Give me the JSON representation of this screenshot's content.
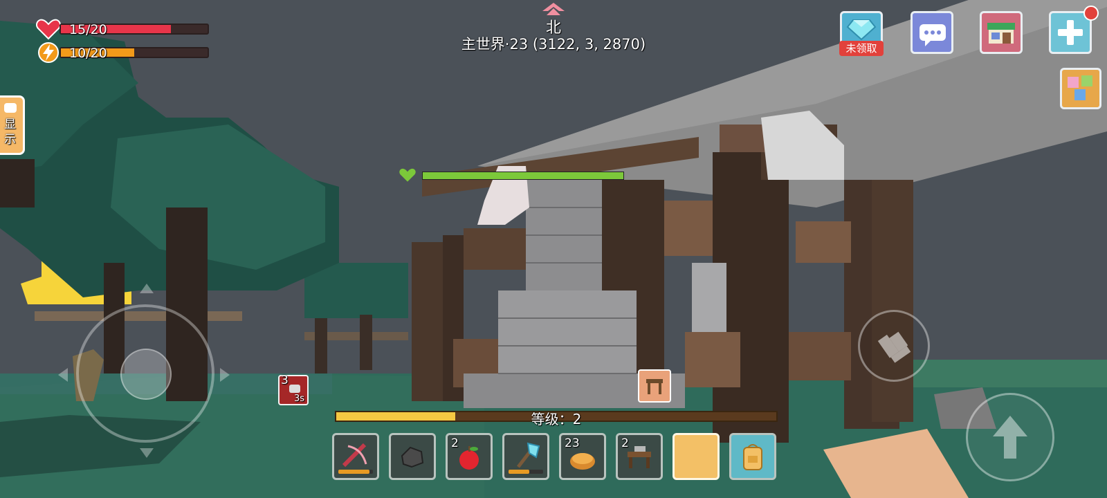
{
  "hud": {
    "health": {
      "value": 15,
      "max": 20,
      "label": "15/20",
      "color": "#e8354a"
    },
    "hunger": {
      "value": 10,
      "max": 20,
      "label": "10/20",
      "color": "#f29a1a"
    }
  },
  "compass": {
    "direction": "北",
    "location": "主世界·23 (3122, 3, 2870)"
  },
  "top_buttons": [
    {
      "name": "diamond-reward-button",
      "badge": "未领取",
      "color": "#5db8d6"
    },
    {
      "name": "chat-button",
      "color": "#7b88d9"
    },
    {
      "name": "shop-button",
      "color": "#d06a7c"
    },
    {
      "name": "add-button",
      "color": "#6ec3d6"
    }
  ],
  "side_chat": {
    "label": "显\n示"
  },
  "target": {
    "health_fraction": 1.0,
    "color": "#7cc83a"
  },
  "buff": {
    "count": "3",
    "timer": "3s"
  },
  "level": {
    "label": "等级：2",
    "progress": 0.27,
    "color": "#f5c842"
  },
  "hotbar": [
    {
      "name": "crossbow-icon",
      "count": "",
      "durability": 0.9
    },
    {
      "name": "coal-icon",
      "count": ""
    },
    {
      "name": "apple-icon",
      "count": "2"
    },
    {
      "name": "diamond-axe-icon",
      "count": "",
      "durability": 0.6
    },
    {
      "name": "bread-icon",
      "count": "23"
    },
    {
      "name": "workbench-icon",
      "count": "2"
    },
    {
      "name": "empty-slot",
      "count": "",
      "selected": true
    },
    {
      "name": "backpack-icon",
      "count": ""
    }
  ]
}
